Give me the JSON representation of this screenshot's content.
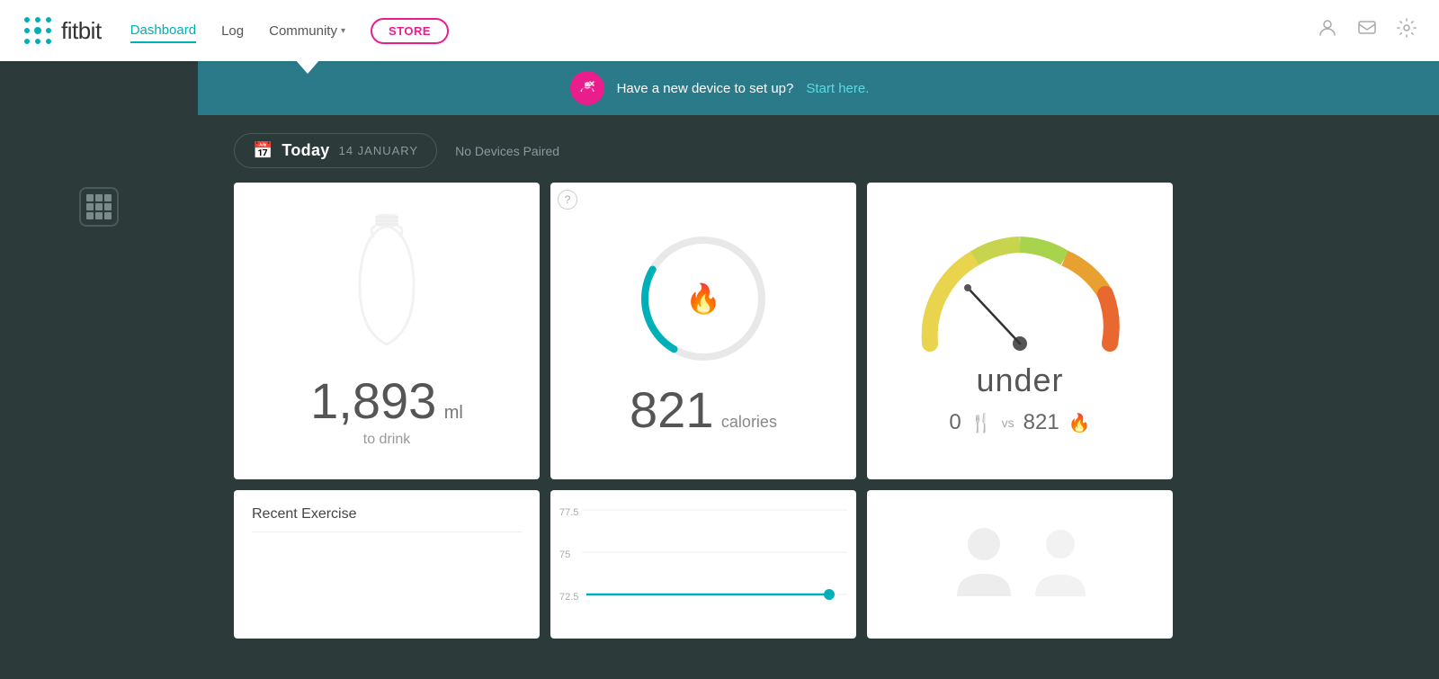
{
  "nav": {
    "logo_text": "fitbit",
    "links": [
      {
        "label": "Dashboard",
        "active": true
      },
      {
        "label": "Log",
        "active": false
      },
      {
        "label": "Community",
        "active": false
      }
    ],
    "community_has_dropdown": true,
    "store_label": "STORE",
    "icons": [
      "person-icon",
      "message-icon",
      "settings-icon"
    ]
  },
  "banner": {
    "text": "Have a new device to set up?",
    "link_text": "Start here.",
    "icon": "link-icon"
  },
  "date_bar": {
    "today_label": "Today",
    "date_text": "14 JANUARY",
    "no_devices_text": "No Devices Paired"
  },
  "cards": {
    "water": {
      "value": "1,893",
      "unit": "ml",
      "label": "to drink"
    },
    "calories": {
      "value": "821",
      "unit": "calories",
      "arc_progress": 0.25
    },
    "balance": {
      "label": "under",
      "food_value": "0",
      "vs_label": "vs",
      "burn_value": "821"
    },
    "exercise": {
      "title": "Recent Exercise"
    },
    "weight": {
      "y_labels": [
        "77.5",
        "75",
        "72.5"
      ],
      "line_color": "#00b0b9"
    },
    "friends": {}
  }
}
